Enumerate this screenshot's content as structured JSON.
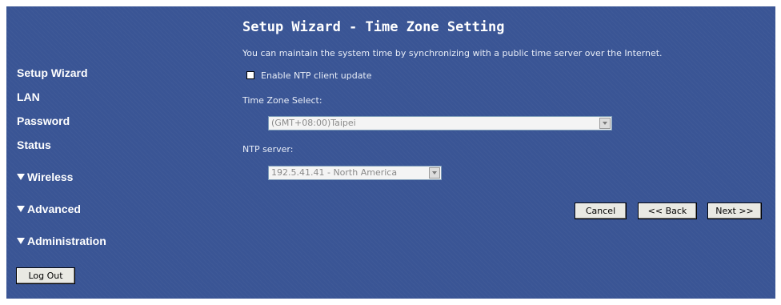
{
  "sidebar": {
    "items": [
      {
        "label": "Setup Wizard"
      },
      {
        "label": "LAN"
      },
      {
        "label": "Password"
      },
      {
        "label": "Status"
      },
      {
        "label": "Wireless"
      },
      {
        "label": "Advanced"
      },
      {
        "label": "Administration"
      }
    ],
    "logout_label": "Log Out"
  },
  "main": {
    "title": "Setup Wizard - Time Zone Setting",
    "description": "You can maintain the system time by synchronizing with a public time server over the Internet.",
    "ntp_checkbox_label": "Enable NTP client update",
    "ntp_checkbox_checked": false,
    "timezone_label": "Time Zone Select:",
    "timezone_value": "(GMT+08:00)Taipei",
    "ntp_server_label": "NTP server:",
    "ntp_server_value": "192.5.41.41 - North America",
    "cancel_label": "Cancel",
    "back_label": "<< Back",
    "next_label": "Next >>"
  },
  "colors": {
    "background": "#3a5595",
    "text": "#ffffff"
  }
}
